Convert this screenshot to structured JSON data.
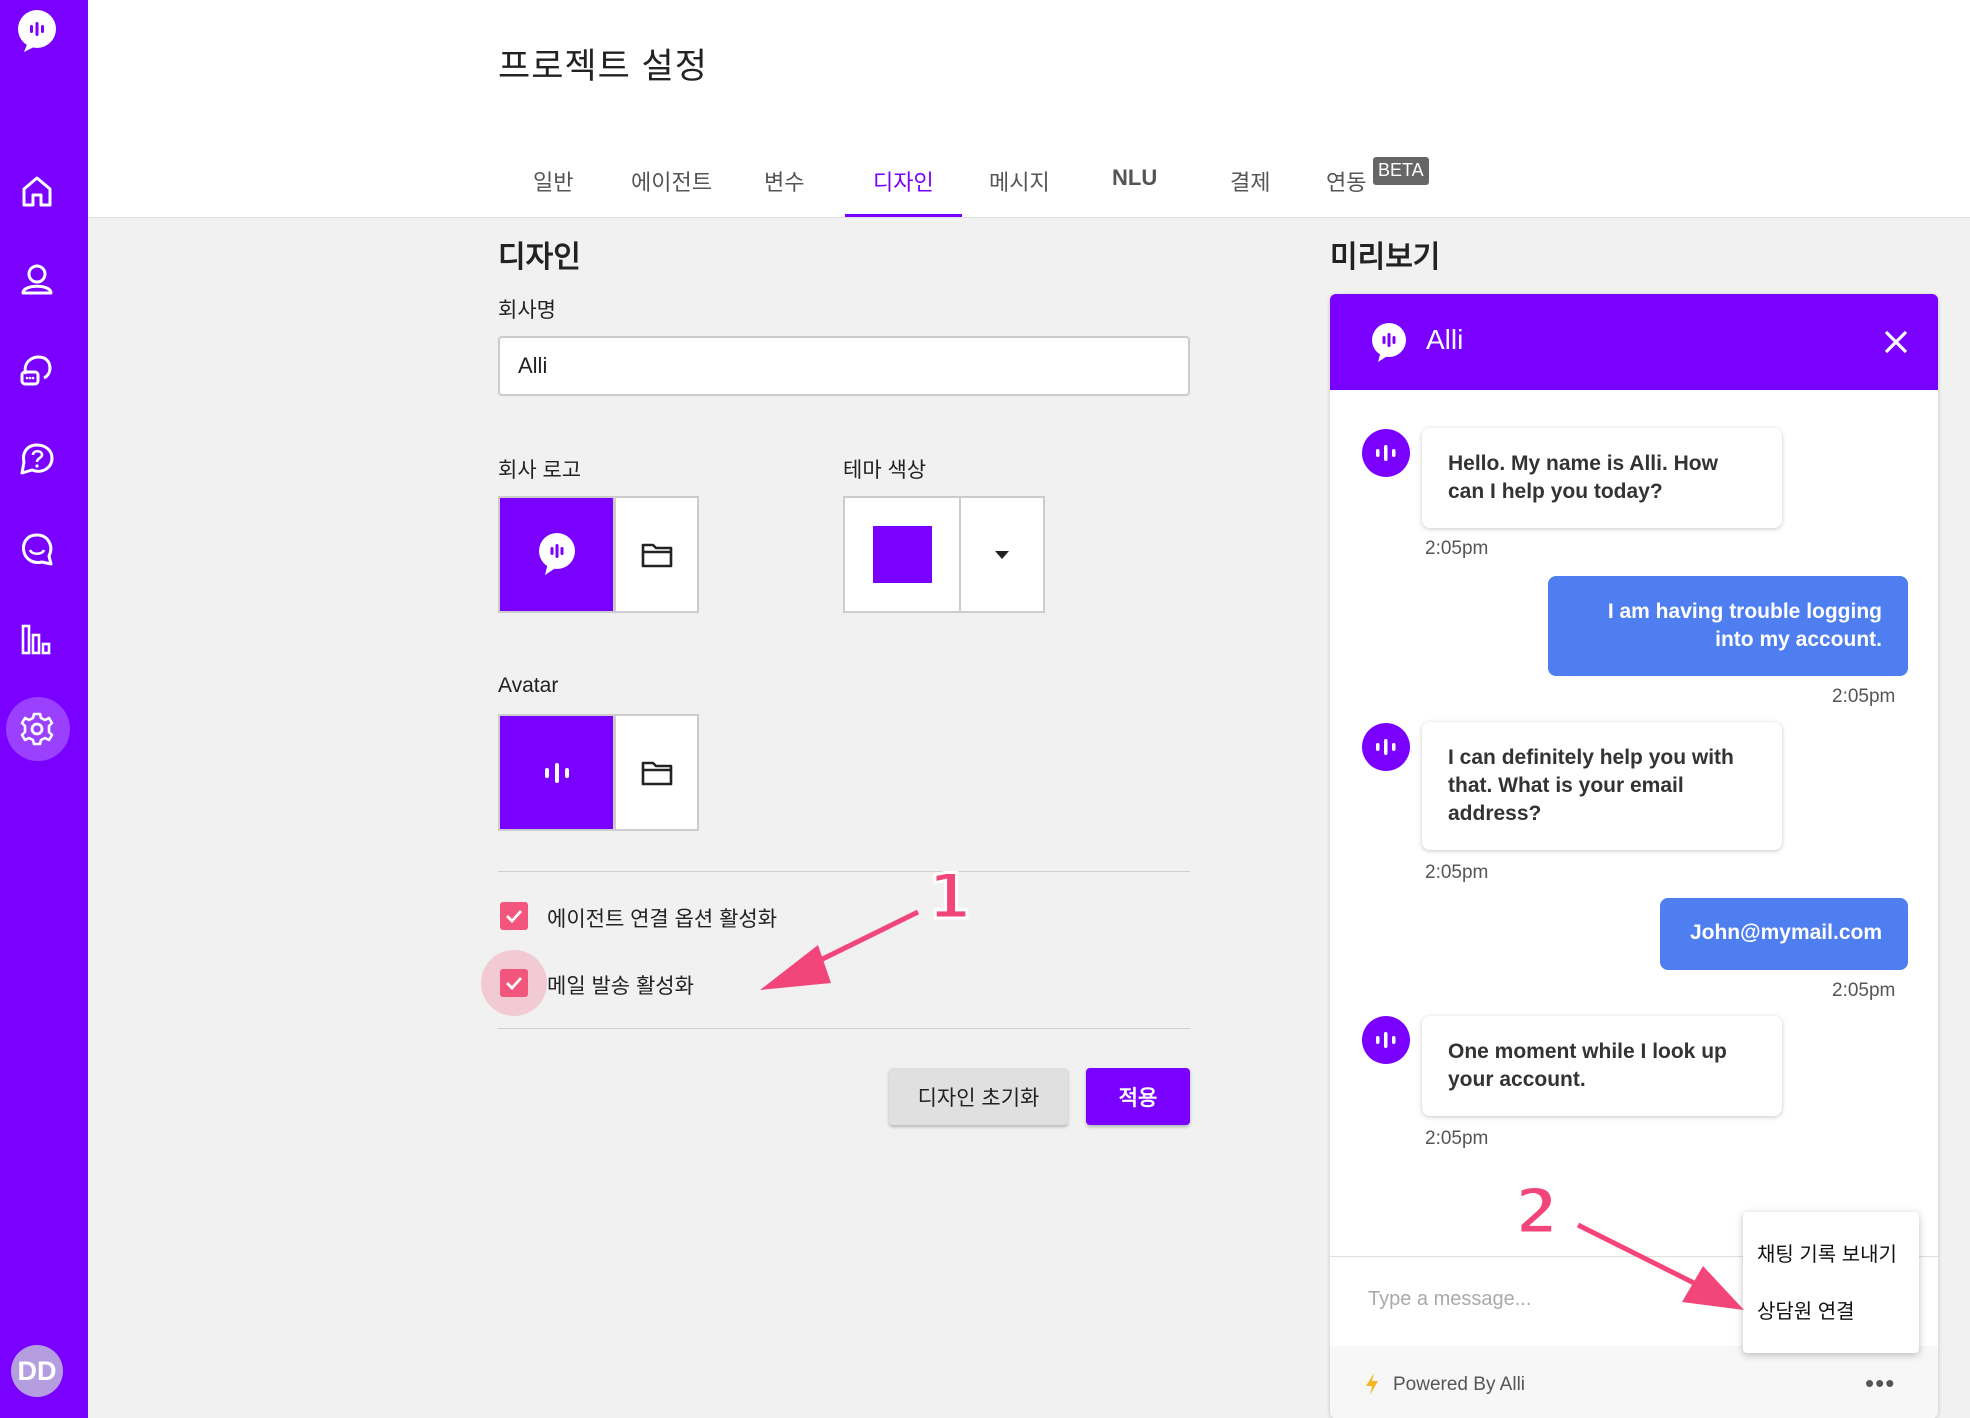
{
  "page_title": "프로젝트 설정",
  "sidebar": {
    "nav_items": [
      "home",
      "users",
      "conversations",
      "faq",
      "chat",
      "analytics",
      "settings"
    ],
    "active": "settings",
    "avatar_initials": "DD",
    "brand_color": "#7a00ff"
  },
  "tabs": [
    {
      "label": "일반"
    },
    {
      "label": "에이전트"
    },
    {
      "label": "변수"
    },
    {
      "label": "디자인",
      "active": true
    },
    {
      "label": "메시지"
    },
    {
      "label": "NLU"
    },
    {
      "label": "결제"
    },
    {
      "label": "연동",
      "badge": "BETA"
    }
  ],
  "design": {
    "section_title": "디자인",
    "company_name_label": "회사명",
    "company_name_value": "Alli",
    "logo_label": "회사 로고",
    "theme_color_label": "테마 색상",
    "theme_color": "#7a00ff",
    "avatar_label": "Avatar",
    "options": [
      {
        "label": "에이전트 연결 옵션 활성화",
        "checked": true
      },
      {
        "label": "메일 발송 활성화",
        "checked": true
      }
    ],
    "reset_button": "디자인 초기화",
    "apply_button": "적용"
  },
  "preview": {
    "section_title": "미리보기",
    "title": "Alli",
    "messages": [
      {
        "from": "bot",
        "text_line1": "Hello. My name is Alli. How",
        "text_line2": "can I help you today?",
        "time": "2:05pm"
      },
      {
        "from": "user",
        "text_line1": "I am having trouble logging",
        "text_line2": "into my account.",
        "time": "2:05pm"
      },
      {
        "from": "bot",
        "text_line1": "I can definitely help you with",
        "text_line2": "that. What is your email",
        "text_line3": "address?",
        "time": "2:05pm"
      },
      {
        "from": "user",
        "text_line1": "John@mymail.com",
        "time": "2:05pm"
      },
      {
        "from": "bot",
        "text_line1": "One moment while I look up",
        "text_line2": "your account.",
        "time": "2:05pm"
      }
    ],
    "input_placeholder": "Type a message...",
    "powered_by": "Powered By Alli",
    "more_label": "•••",
    "menu_items": [
      "채팅 기록 보내기",
      "상담원 연결"
    ],
    "user_bubble_color": "#4f7ef0"
  },
  "annotations": {
    "label_1": "1",
    "label_2": "2",
    "color": "#f2457a"
  }
}
